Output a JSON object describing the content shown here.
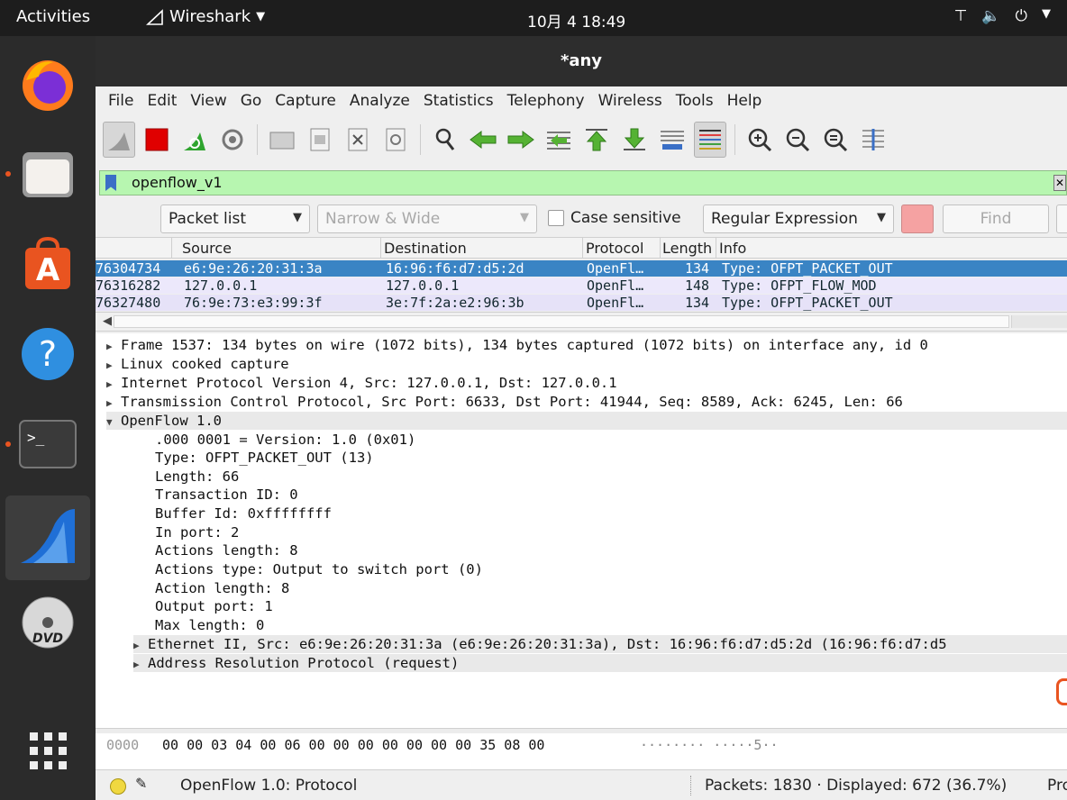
{
  "topbar": {
    "activities": "Activities",
    "app_name": "Wireshark",
    "clock": "10月 4 18:49"
  },
  "dock": {
    "items": [
      "firefox-icon",
      "files-icon",
      "software-center-icon",
      "help-icon",
      "terminal-icon",
      "wireshark-icon",
      "dvd-icon",
      "show-apps-icon"
    ],
    "accent": "#e95420"
  },
  "window": {
    "title": "*any"
  },
  "menubar": {
    "file": "File",
    "edit": "Edit",
    "view": "View",
    "go": "Go",
    "capture": "Capture",
    "analyze": "Analyze",
    "statistics": "Statistics",
    "telephony": "Telephony",
    "wireless": "Wireless",
    "tools": "Tools",
    "help": "Help"
  },
  "filter": {
    "value": "openflow_v1",
    "background": "#b7f6b0"
  },
  "findbar": {
    "search_in": "Packet list",
    "char_width": "Narrow & Wide",
    "case_sensitive": "Case sensitive",
    "search_type": "Regular Expression",
    "find_button": "Find"
  },
  "packet_list": {
    "columns": [
      "Source",
      "Destination",
      "Protocol",
      "Length",
      "Info"
    ],
    "rows": [
      {
        "time": "76304734",
        "source": "e6:9e:26:20:31:3a",
        "destination": "16:96:f6:d7:d5:2d",
        "protocol": "OpenFl…",
        "length": "134",
        "info": "Type: OFPT_PACKET_OUT"
      },
      {
        "time": "76316282",
        "source": "127.0.0.1",
        "destination": "127.0.0.1",
        "protocol": "OpenFl…",
        "length": "148",
        "info": "Type: OFPT_FLOW_MOD"
      },
      {
        "time": "76327480",
        "source": "76:9e:73:e3:99:3f",
        "destination": "3e:7f:2a:e2:96:3b",
        "protocol": "OpenFl…",
        "length": "134",
        "info": "Type: OFPT_PACKET_OUT"
      }
    ],
    "selected_color": "#3a84c4"
  },
  "details": {
    "frame": "Frame 1537: 134 bytes on wire (1072 bits), 134 bytes captured (1072 bits) on interface any, id 0",
    "linux": "Linux cooked capture",
    "ip": "Internet Protocol Version 4, Src: 127.0.0.1, Dst: 127.0.0.1",
    "tcp": "Transmission Control Protocol, Src Port: 6633, Dst Port: 41944, Seq: 8589, Ack: 6245, Len: 66",
    "openflow": "OpenFlow 1.0",
    "version": ".000 0001 = Version: 1.0 (0x01)",
    "type": "Type: OFPT_PACKET_OUT (13)",
    "length": "Length: 66",
    "xid": "Transaction ID: 0",
    "buffer": "Buffer Id: 0xffffffff",
    "in_port": "In port: 2",
    "actions_len": "Actions length: 8",
    "actions_type": "Actions type: Output to switch port (0)",
    "action_len": "Action length: 8",
    "output_port": "Output port: 1",
    "max_len": "Max length: 0",
    "ethernet": "Ethernet II, Src: e6:9e:26:20:31:3a (e6:9e:26:20:31:3a), Dst: 16:96:f6:d7:d5:2d (16:96:f6:d7:d5",
    "arp": "Address Resolution Protocol (request)"
  },
  "hex": {
    "offset": "0000",
    "bytes": "00 00 03 04 00 06 00 00  00 00 00 00 00 35 08 00",
    "ascii": "········ ·····5··"
  },
  "statusbar": {
    "message": "OpenFlow 1.0: Protocol",
    "packets": "Packets: 1830 · Displayed: 672 (36.7%)",
    "profile": "Pro"
  }
}
